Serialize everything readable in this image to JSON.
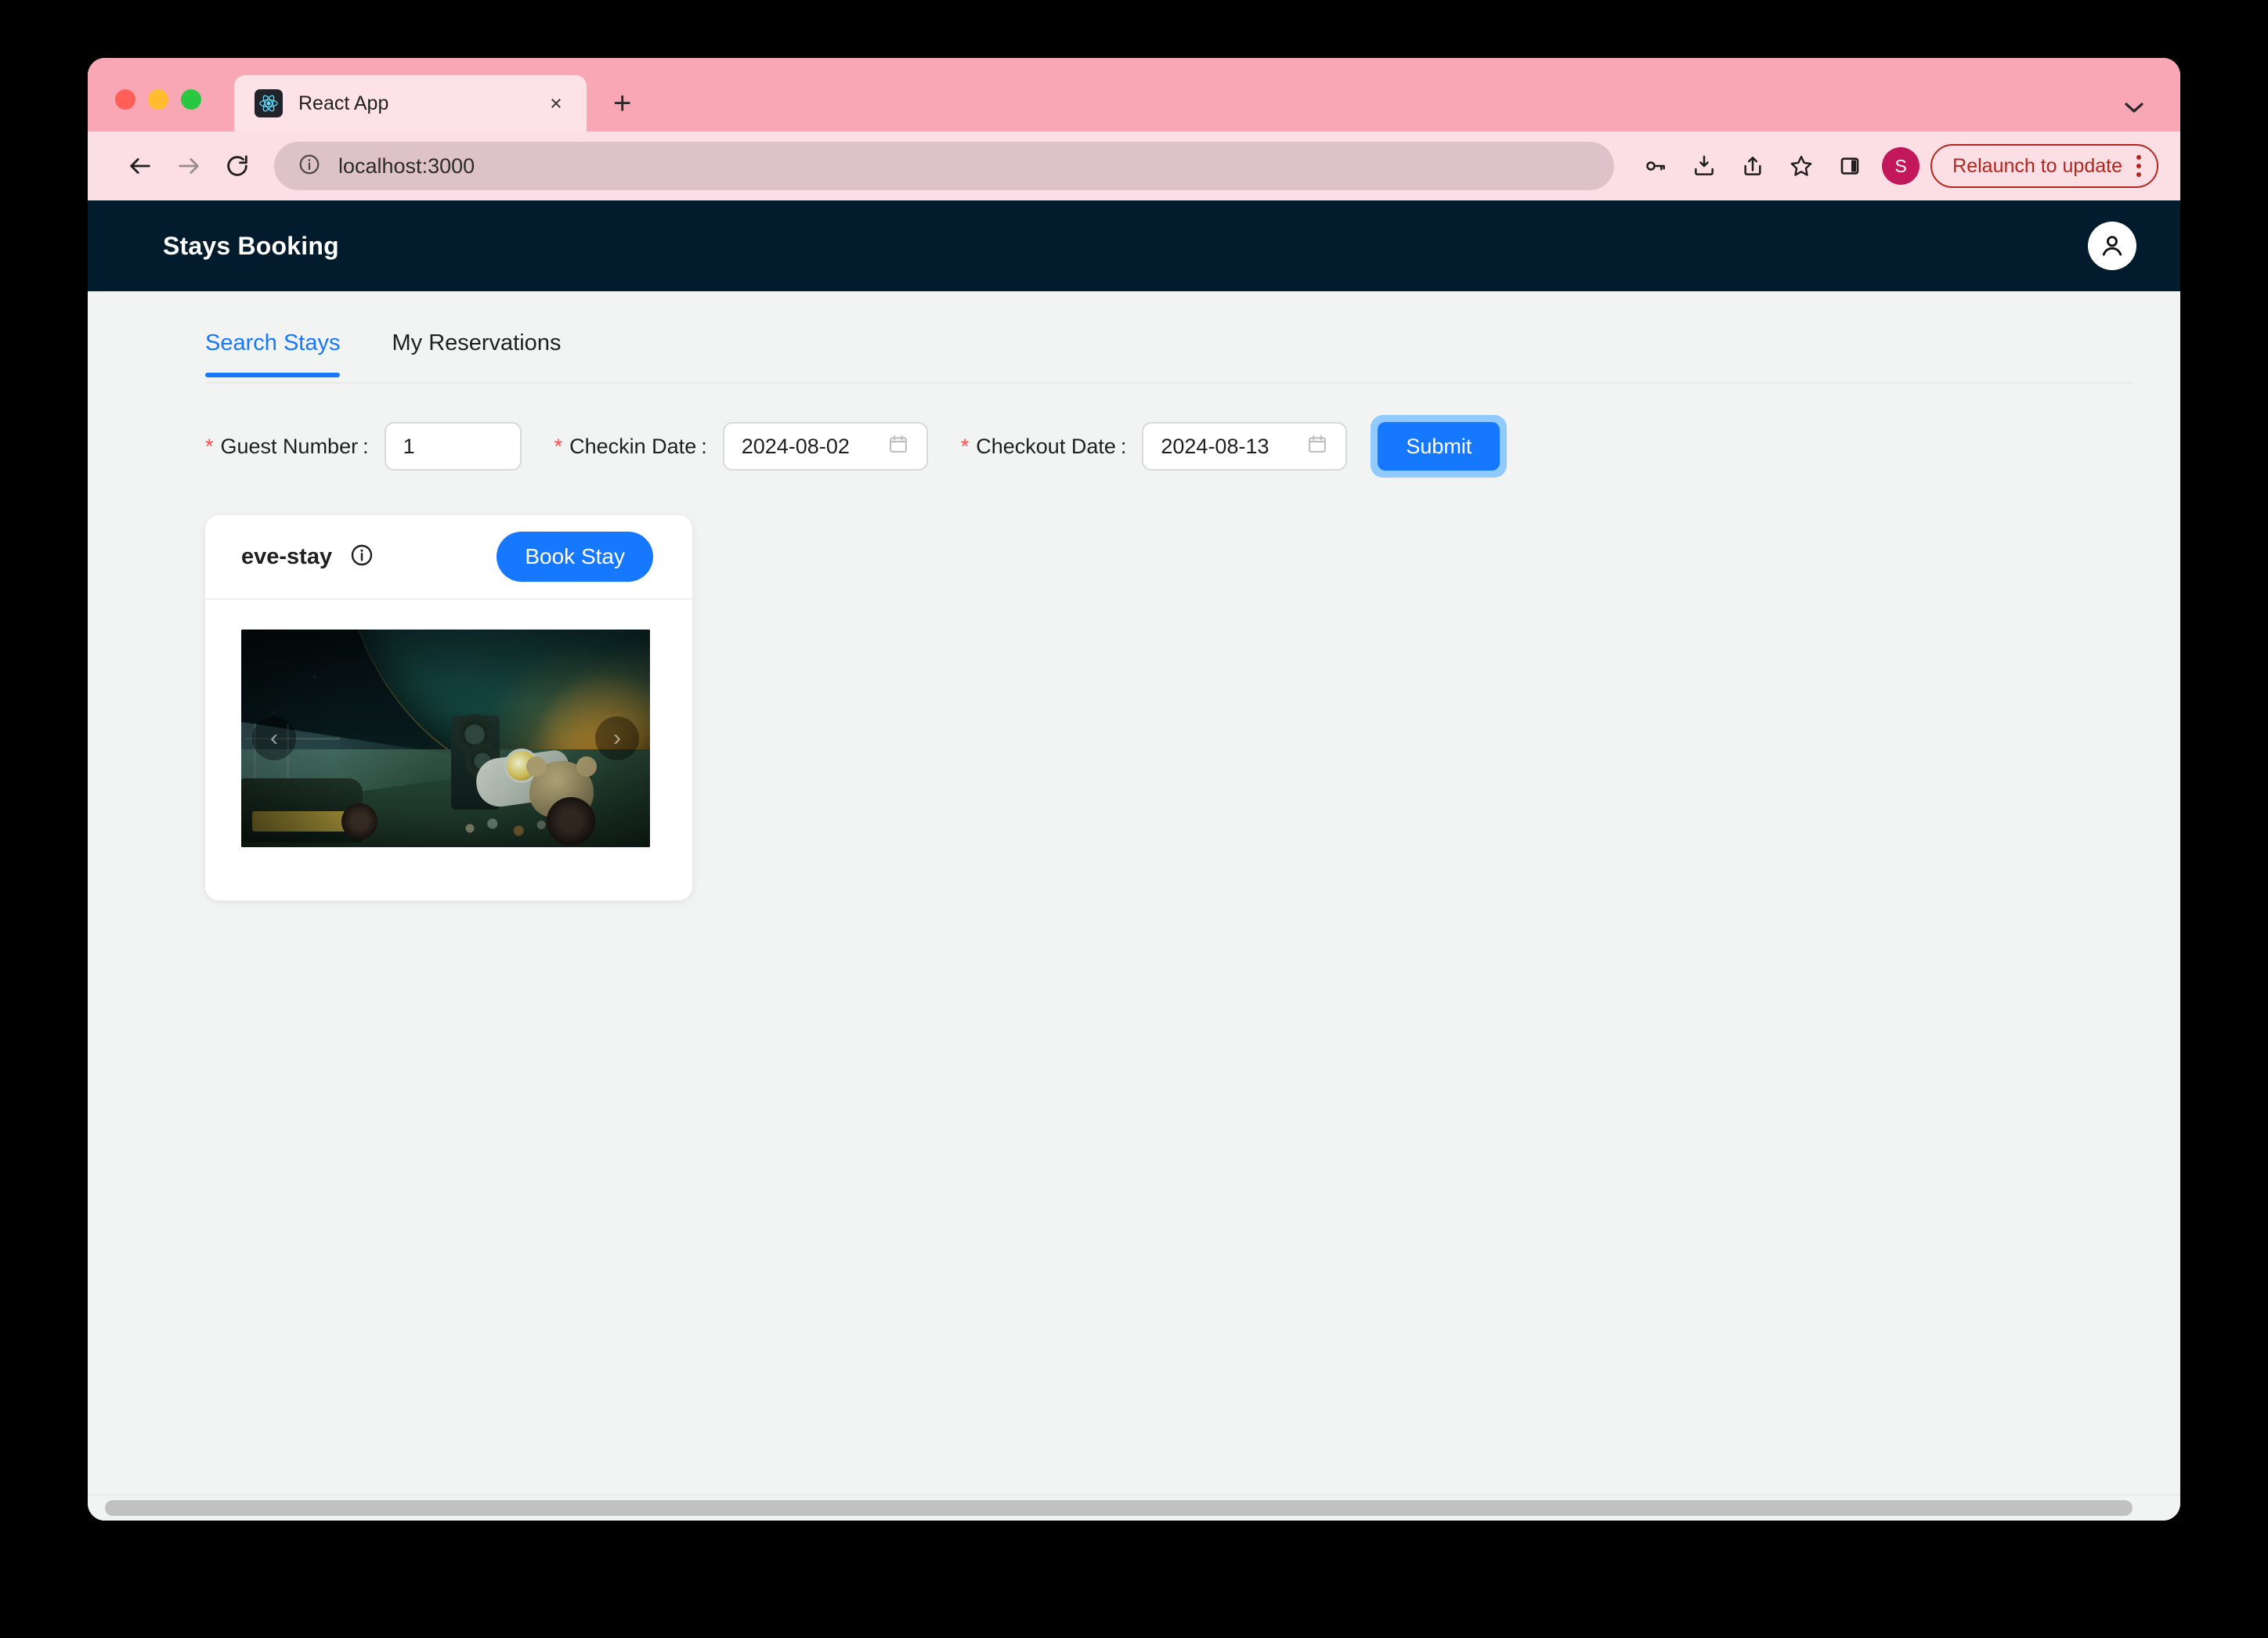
{
  "browser": {
    "tab": {
      "title": "React App",
      "favicon": "react-logo-icon",
      "close": "×"
    },
    "new_tab_label": "+",
    "address": {
      "url": "localhost:3000",
      "info_icon": "info-circle-icon"
    },
    "toolbar_icons": [
      "back-arrow-icon",
      "forward-arrow-icon",
      "reload-icon",
      "password-key-icon",
      "install-app-icon",
      "share-icon",
      "bookmark-star-icon",
      "side-panel-icon"
    ],
    "profile_initial": "S",
    "relaunch_label": "Relaunch to update",
    "traffic_lights": {
      "close": "#ff5f57",
      "minimize": "#febc2e",
      "maximize": "#28c840"
    },
    "colors": {
      "tabstrip": "#f9a7b4",
      "tab_active": "#fde3e8",
      "toolbar": "#fcdfe4",
      "omnibox": "#ddc3c9",
      "relaunch": "#b3261e",
      "profile": "#c2185b"
    }
  },
  "app": {
    "header": {
      "title": "Stays Booking",
      "avatar_icon": "user-avatar-icon",
      "bg": "#021c2e"
    },
    "tabs": [
      {
        "label": "Search Stays",
        "active": true
      },
      {
        "label": "My Reservations",
        "active": false
      }
    ],
    "accent": "#1677ff",
    "search_form": {
      "guest": {
        "required_mark": "*",
        "label": "Guest Number",
        "colon": ":",
        "value": "1",
        "placeholder": ""
      },
      "checkin": {
        "required_mark": "*",
        "label": "Checkin Date",
        "colon": ":",
        "value": "2024-08-02",
        "icon": "calendar-icon"
      },
      "checkout": {
        "required_mark": "*",
        "label": "Checkout Date",
        "colon": ":",
        "value": "2024-08-13",
        "icon": "calendar-icon"
      },
      "submit_label": "Submit"
    },
    "results": [
      {
        "name": "eve-stay",
        "info_icon": "info-circle-icon",
        "book_label": "Book Stay",
        "carousel": {
          "prev": "‹",
          "next": "›"
        }
      }
    ]
  }
}
